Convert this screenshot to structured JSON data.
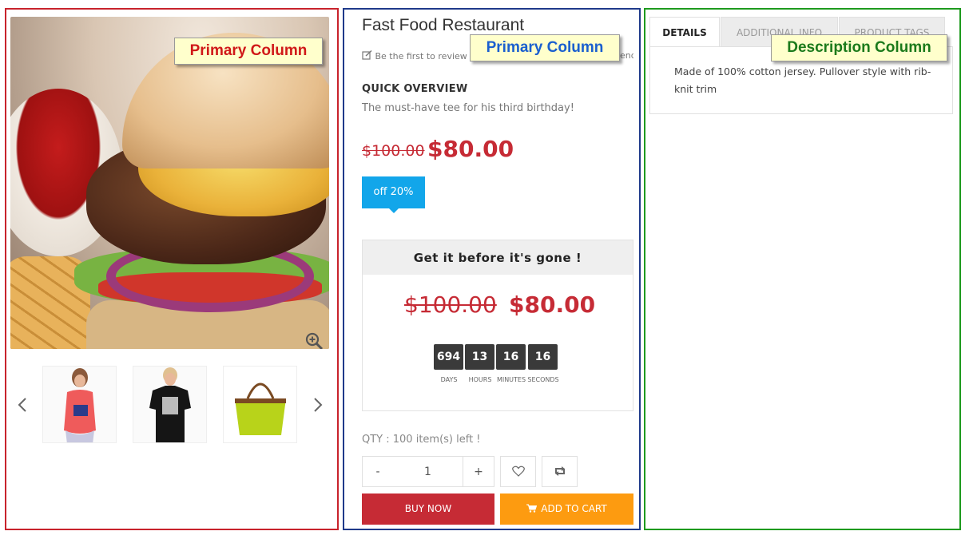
{
  "callouts": {
    "left": "Primary Column",
    "middle": "Primary Column",
    "right": "Description Column"
  },
  "product": {
    "title": "Fast Food Restaurant",
    "review_prompt_visible": "Be the first to review",
    "review_prompt_tail": "end",
    "quick_overview_heading": "QUICK OVERVIEW",
    "quick_overview_text": "The must-have tee for his third birthday!",
    "old_price": "$100.00",
    "new_price": "$80.00",
    "discount": "off 20%"
  },
  "deal": {
    "heading": "Get it before it's gone !",
    "old_price": "$100.00",
    "new_price": "$80.00",
    "countdown": [
      {
        "value": "694",
        "label": "DAYS"
      },
      {
        "value": "13",
        "label": "HOURS"
      },
      {
        "value": "16",
        "label": "MINUTES"
      },
      {
        "value": "16",
        "label": "SECONDS"
      }
    ]
  },
  "cart": {
    "qty_label": "QTY : 100 item(s) left !",
    "minus": "-",
    "qty_value": "1",
    "plus": "+",
    "buy_now": "BUY NOW",
    "add_to_cart": "ADD TO CART"
  },
  "tabs": {
    "details": "DETAILS",
    "additional": "ADDITIONAL INFO",
    "tags": "PRODUCT TAGS",
    "details_text": "Made of 100% cotton jersey. Pullover style with rib-knit trim"
  },
  "colors": {
    "price_red": "#c62b35",
    "badge_blue": "#12a6ea",
    "cart_orange": "#fd9b10"
  },
  "icons": [
    "zoom-in-icon",
    "chevron-left-icon",
    "chevron-right-icon",
    "edit-icon",
    "heart-icon",
    "retweet-icon",
    "cart-icon"
  ]
}
